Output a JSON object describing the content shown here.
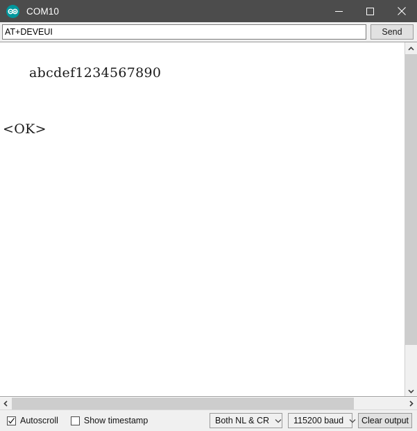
{
  "window": {
    "title": "COM10",
    "logo_icon": "arduino-logo-icon",
    "controls": {
      "minimize_icon": "minimize-icon",
      "maximize_icon": "maximize-icon",
      "close_icon": "close-icon"
    },
    "titlebar_color": "#4c4c4c",
    "accent_color": "#00979d"
  },
  "command_row": {
    "input_value": "AT+DEVEUI",
    "input_placeholder": "",
    "send_label": "Send"
  },
  "console": {
    "lines": [
      "abcdef1234567890",
      "",
      "<OK>"
    ],
    "text_color": "#1a1a1a",
    "background": "#ffffff"
  },
  "scrollbars": {
    "vertical": {
      "up_icon": "chevron-up-icon",
      "down_icon": "chevron-down-icon",
      "thumb_fraction": 88
    },
    "horizontal": {
      "left_icon": "chevron-left-icon",
      "right_icon": "chevron-right-icon",
      "thumb_fraction": 87
    }
  },
  "status_bar": {
    "autoscroll": {
      "label": "Autoscroll",
      "checked": true,
      "check_icon": "checkmark-icon"
    },
    "show_timestamp": {
      "label": "Show timestamp",
      "checked": false
    },
    "line_ending": {
      "value": "Both NL & CR",
      "caret_icon": "chevron-down-icon"
    },
    "baud_rate": {
      "value": "115200 baud",
      "caret_icon": "chevron-down-icon"
    },
    "clear_label": "Clear output"
  }
}
